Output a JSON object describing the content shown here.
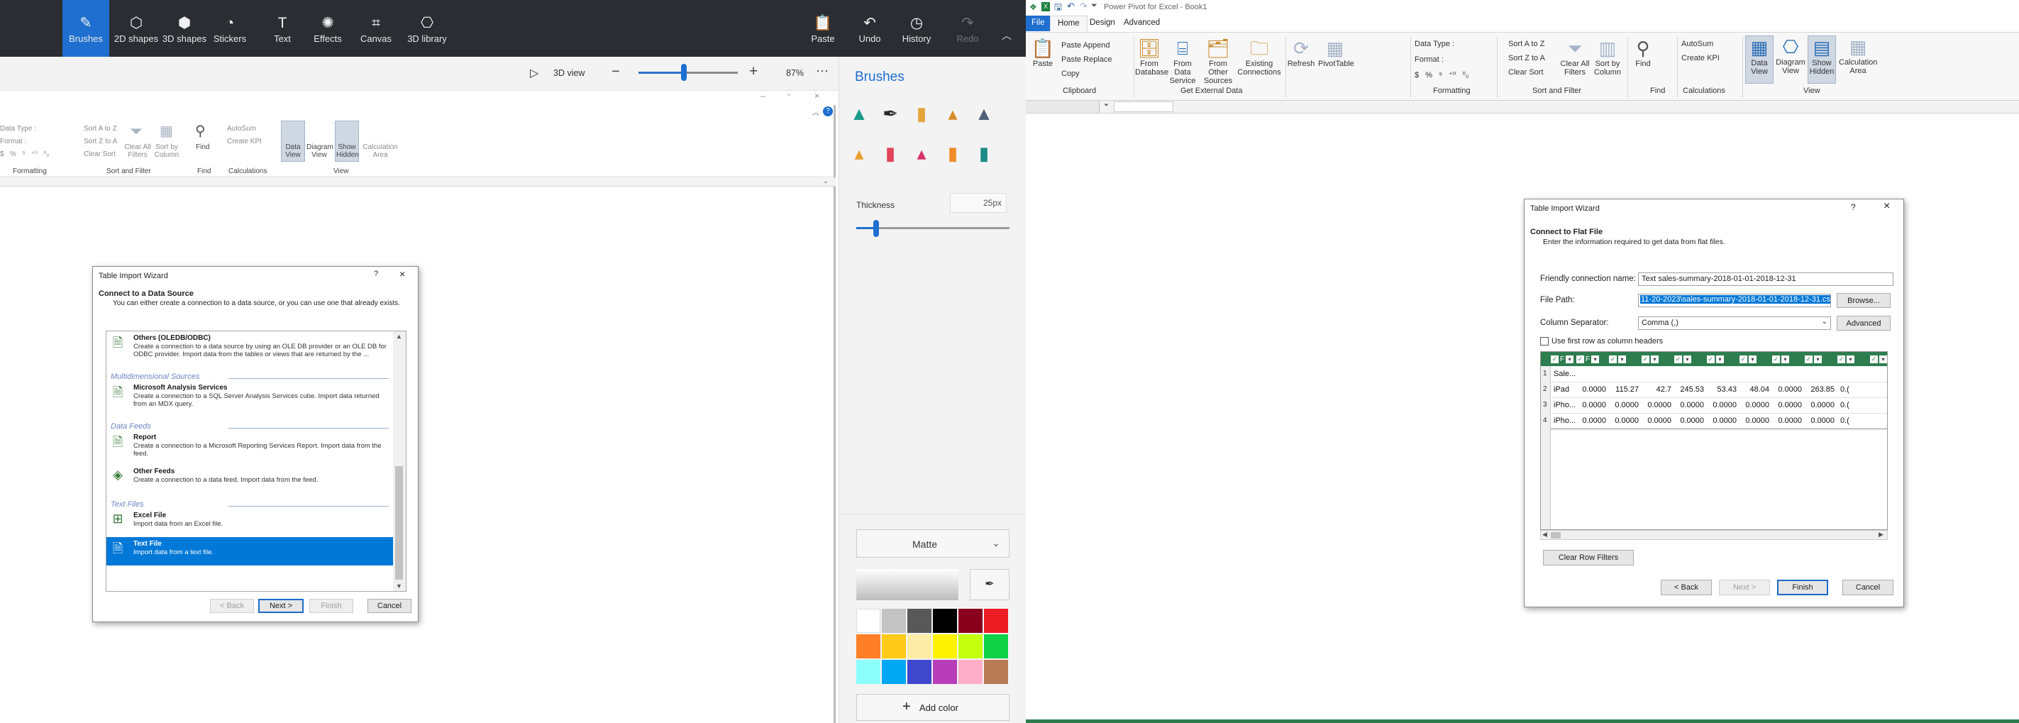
{
  "paint3d": {
    "tools": [
      {
        "label": "Brushes",
        "icon": "brush-icon",
        "glyph": "✎",
        "active": true
      },
      {
        "label": "2D shapes",
        "icon": "shapes-2d-icon",
        "glyph": "⬡",
        "active": false
      },
      {
        "label": "3D shapes",
        "icon": "cube-icon",
        "glyph": "⬢",
        "active": false
      },
      {
        "label": "Stickers",
        "icon": "sticker-icon",
        "glyph": "◔",
        "active": false
      },
      {
        "label": "Text",
        "icon": "text-icon",
        "glyph": "T",
        "active": false
      },
      {
        "label": "Effects",
        "icon": "effects-icon",
        "glyph": "✺",
        "active": false
      },
      {
        "label": "Canvas",
        "icon": "canvas-icon",
        "glyph": "⌗",
        "active": false
      },
      {
        "label": "3D library",
        "icon": "library-icon",
        "glyph": "⎔",
        "active": false
      }
    ],
    "actions": [
      {
        "label": "Paste",
        "icon": "paste-icon",
        "glyph": "📋",
        "enabled": true
      },
      {
        "label": "Undo",
        "icon": "undo-icon",
        "glyph": "↶",
        "enabled": true
      },
      {
        "label": "History",
        "icon": "history-icon",
        "glyph": "◷",
        "enabled": true
      },
      {
        "label": "Redo",
        "icon": "redo-icon",
        "glyph": "↷",
        "enabled": false
      }
    ],
    "view_label": "3D view",
    "zoom_value": "87%",
    "zoom_fraction": 0.45,
    "panel": {
      "title": "Brushes",
      "thickness_label": "Thickness",
      "thickness_value": "25px",
      "thickness_fraction": 0.13,
      "material": "Matte",
      "add_color": "Add color",
      "palette": [
        "#ffffff",
        "#c3c3c3",
        "#585858",
        "#000000",
        "#88001b",
        "#ec1c24",
        "#ff7f27",
        "#ffca18",
        "#fdeca6",
        "#fff200",
        "#c4ff0e",
        "#0ed145",
        "#8cfffb",
        "#00a8f3",
        "#3f48cc",
        "#b83dba",
        "#ffaec9",
        "#b97a56"
      ],
      "brush_colors": [
        "#1a9c8c",
        "#2a2a2a",
        "#e5a33a",
        "#d98a2a",
        "#50607a",
        "#e8a030",
        "#e0445a",
        "#d8336a",
        "#f08c28",
        "#1e8c86"
      ]
    },
    "inner_pp": {
      "ribbon": {
        "data_type": "Data Type :",
        "format": "Format :",
        "sort_az": "Sort A to Z",
        "sort_za": "Sort Z to A",
        "clear_sort": "Clear Sort",
        "clear_all_filters": "Clear All Filters",
        "sort_by_column": "Sort by Column",
        "find": "Find",
        "autosum": "AutoSum",
        "create_kpi": "Create KPI",
        "data_view": "Data View",
        "diagram_view": "Diagram View",
        "show_hidden": "Show Hidden",
        "calc_area": "Calculation Area",
        "groups": [
          "Formatting",
          "Sort and Filter",
          "Find",
          "Calculations",
          "View"
        ]
      },
      "wizard": {
        "title": "Table Import Wizard",
        "heading": "Connect to a Data Source",
        "subheading": "You can either create a connection to a data source, or you can use one that already exists.",
        "items": [
          {
            "type": "item",
            "title": "Others (OLEDB/ODBC)",
            "desc": "Create a connection to a data source by using an OLE DB provider or an OLE DB for ODBC provider. Import data from the tables or views that are returned by the ..."
          },
          {
            "type": "cat",
            "title": "Multidimensional Sources"
          },
          {
            "type": "item",
            "title": "Microsoft Analysis Services",
            "desc": "Create a connection to a SQL Server Analysis Services cube. Import data returned from an MDX query."
          },
          {
            "type": "cat",
            "title": "Data Feeds"
          },
          {
            "type": "item",
            "title": "Report",
            "desc": "Create a connection to a Microsoft Reporting Services Report. Import data from the feed."
          },
          {
            "type": "item",
            "title": "Other Feeds",
            "desc": "Create a connection to a data feed. Import data from the feed."
          },
          {
            "type": "cat",
            "title": "Text Files"
          },
          {
            "type": "item",
            "title": "Excel File",
            "desc": "Import data from an Excel file."
          },
          {
            "type": "item",
            "title": "Text File",
            "desc": "Import data from a text file.",
            "selected": true
          }
        ],
        "back": "< Back",
        "next": "Next >",
        "finish": "Finish",
        "cancel": "Cancel"
      }
    }
  },
  "powerpivot": {
    "window_title": "Power Pivot for Excel - Book1",
    "tabs": [
      "File",
      "Home",
      "Design",
      "Advanced"
    ],
    "ribbon": {
      "paste": "Paste",
      "paste_append": "Paste Append",
      "paste_replace": "Paste Replace",
      "copy": "Copy",
      "from_database": "From Database",
      "from_data_service": "From Data Service",
      "from_other_sources": "From Other Sources",
      "existing_connections": "Existing Connections",
      "refresh": "Refresh",
      "pivottable": "PivotTable",
      "data_type": "Data Type :",
      "format": "Format :",
      "sort_az": "Sort A to Z",
      "sort_za": "Sort Z to A",
      "clear_sort": "Clear Sort",
      "clear_all_filters": "Clear All Filters",
      "sort_by_column": "Sort by Column",
      "find": "Find",
      "autosum": "AutoSum",
      "create_kpi": "Create KPI",
      "data_view": "Data View",
      "diagram_view": "Diagram View",
      "show_hidden": "Show Hidden",
      "calc_area": "Calculation Area",
      "groups": [
        "Clipboard",
        "Get External Data",
        "Formatting",
        "Sort and Filter",
        "Find",
        "Calculations",
        "View"
      ]
    },
    "wizard": {
      "title": "Table Import Wizard",
      "heading": "Connect to Flat File",
      "subheading": "Enter the information required to get data from flat files.",
      "friendly_label": "Friendly connection name:",
      "friendly_value": "Text sales-summary-2018-01-01-2018-12-31",
      "filepath_label": "File Path:",
      "filepath_value": "11-20-2023\\sales-summary-2018-01-01-2018-12-31.csv",
      "browse": "Browse...",
      "separator_label": "Column Separator:",
      "separator_value": "Comma (,)",
      "advanced": "Advanced",
      "first_row": "Use first row as column headers",
      "preview_rows": [
        {
          "n": "1",
          "name": "Sale...",
          "vals": [
            "",
            "",
            "",
            "",
            "",
            "",
            "",
            "",
            ""
          ]
        },
        {
          "n": "2",
          "name": "iPad",
          "vals": [
            "0.0000",
            "115.27",
            "42.7",
            "245.53",
            "53.43",
            "48.04",
            "0.0000",
            "263.85",
            "0.("
          ]
        },
        {
          "n": "3",
          "name": "iPho...",
          "vals": [
            "0.0000",
            "0.0000",
            "0.0000",
            "0.0000",
            "0.0000",
            "0.0000",
            "0.0000",
            "0.0000",
            "0.("
          ]
        },
        {
          "n": "4",
          "name": "iPho...",
          "vals": [
            "0.0000",
            "0.0000",
            "0.0000",
            "0.0000",
            "0.0000",
            "0.0000",
            "0.0000",
            "0.0000",
            "0.("
          ]
        }
      ],
      "header_f": "F",
      "clear_row_filters": "Clear Row Filters",
      "back": "< Back",
      "next": "Next >",
      "finish": "Finish",
      "cancel": "Cancel"
    }
  },
  "colors": {
    "paint_dark": "#2b2d33",
    "accent_blue": "#1f6fd0",
    "pp_file_tab": "#1e6fd0",
    "grid_header_green": "#2e7d4f",
    "selection": "#0078d7"
  }
}
